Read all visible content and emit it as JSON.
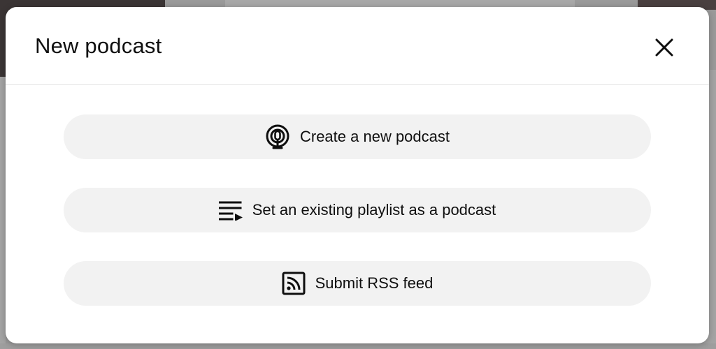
{
  "dialog": {
    "title": "New podcast",
    "close_icon": "close-icon",
    "options": [
      {
        "label": "Create a new podcast",
        "icon": "podcast-icon"
      },
      {
        "label": "Set an existing playlist as a podcast",
        "icon": "playlist-icon"
      },
      {
        "label": "Submit RSS feed",
        "icon": "rss-icon"
      }
    ]
  },
  "colors": {
    "dialog_bg": "#ffffff",
    "button_bg": "#f2f2f2",
    "text": "#0f0f0f",
    "overlay": "#9a9a9a"
  }
}
